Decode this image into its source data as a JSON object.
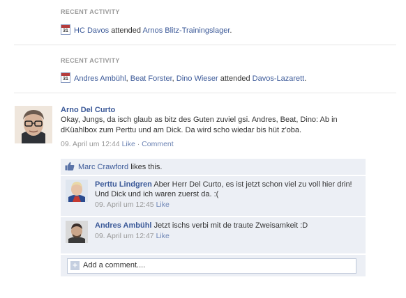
{
  "activities": [
    {
      "heading": "RECENT ACTIVITY",
      "actor": "HC Davos",
      "verb": "attended",
      "event": "Arnos Blitz-Trainingslager",
      "end": ".",
      "calendar_day": "31"
    },
    {
      "heading": "RECENT ACTIVITY",
      "actors": [
        "Andres Ambühl",
        "Beat Forster",
        "Dino Wieser"
      ],
      "sep1": ", ",
      "sep2": ", ",
      "verb": "attended",
      "event": "Davos-Lazarett",
      "end": ".",
      "calendar_day": "31"
    }
  ],
  "post": {
    "author": "Arno Del Curto",
    "text": "Okay, Jungs, da isch glaub as bitz des Guten zuviel gsi. Andres, Beat, Dino: Ab in dKüahlbox zum Perttu und am Dick. Da wird scho wiedar bis hüt z'oba.",
    "timestamp": "09. April um 12:44",
    "like_label": "Like",
    "dot": "·",
    "comment_label": "Comment"
  },
  "likes": {
    "name": "Marc Crawford",
    "text": "likes this."
  },
  "comments": [
    {
      "author": "Perttu Lindgren",
      "text": "Aber Herr Del Curto, es ist jetzt schon viel zu voll hier drin! Und Dick und ich waren zuerst da. :(",
      "timestamp": "09. April um 12:45",
      "like_label": "Like"
    },
    {
      "author": "Andres Ambühl",
      "text": "Jetzt ischs verbi mit de traute Zweisamkeit :D",
      "timestamp": "09. April um 12:47",
      "like_label": "Like"
    }
  ],
  "add_comment": {
    "placeholder": "Add a comment...."
  },
  "colors": {
    "link": "#3b5998",
    "panel": "#eceff5",
    "muted": "#999999"
  }
}
